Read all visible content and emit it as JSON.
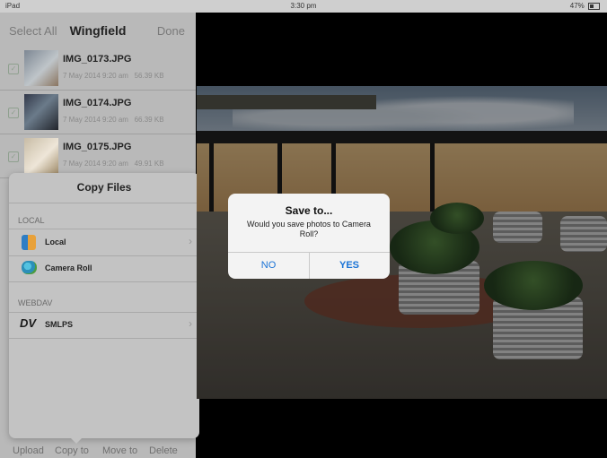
{
  "status_bar": {
    "device": "iPad",
    "time": "3:30 pm",
    "battery": "47%"
  },
  "nav": {
    "select_all": "Select All",
    "title": "Wingfield",
    "done": "Done"
  },
  "files": [
    {
      "name": "IMG_0173.JPG",
      "date": "7 May 2014 9:20 am",
      "size": "56.39 KB"
    },
    {
      "name": "IMG_0174.JPG",
      "date": "7 May 2014 9:20 am",
      "size": "66.39 KB"
    },
    {
      "name": "IMG_0175.JPG",
      "date": "7 May 2014 9:20 am",
      "size": "49.91 KB"
    }
  ],
  "copy_popup": {
    "title": "Copy Files",
    "local_section": "LOCAL",
    "local_label": "Local",
    "camera_roll_label": "Camera Roll",
    "webdav_section": "WEBDAV",
    "smlps_label": "SMLPS"
  },
  "toolbar": {
    "upload": "Upload",
    "copy_to": "Copy to",
    "move_to": "Move to",
    "delete": "Delete"
  },
  "alert": {
    "title": "Save to...",
    "message": "Would you save photos to Camera Roll?",
    "no": "NO",
    "yes": "YES"
  },
  "colors": {
    "accent": "#1a73d6",
    "panel": "#b9b9b9"
  }
}
